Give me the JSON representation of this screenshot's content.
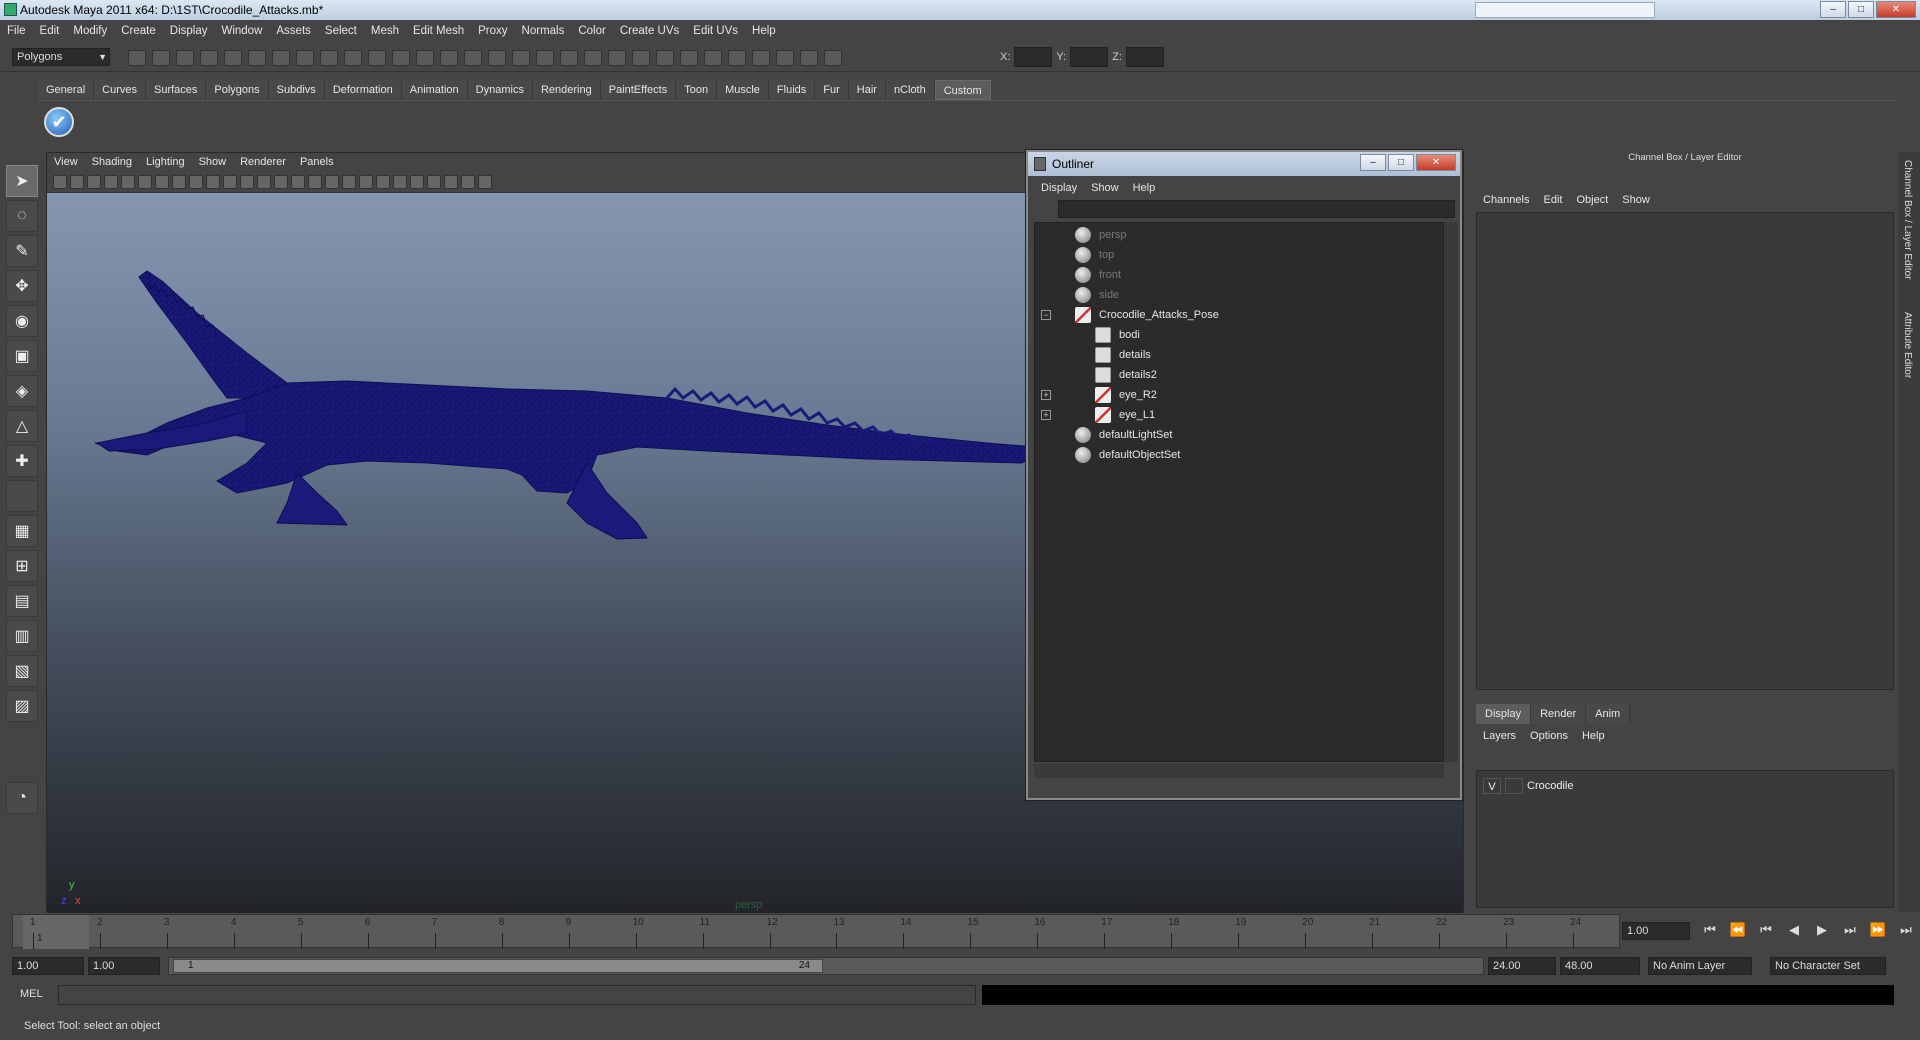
{
  "window": {
    "title": "Autodesk Maya 2011 x64: D:\\1ST\\Crocodile_Attacks.mb*",
    "min": "–",
    "max": "□",
    "close": "✕"
  },
  "menubar": [
    "File",
    "Edit",
    "Modify",
    "Create",
    "Display",
    "Window",
    "Assets",
    "Select",
    "Mesh",
    "Edit Mesh",
    "Proxy",
    "Normals",
    "Color",
    "Create UVs",
    "Edit UVs",
    "Help"
  ],
  "statusline": {
    "mode": "Polygons",
    "x_label": "X:",
    "y_label": "Y:",
    "z_label": "Z:"
  },
  "shelf_tabs": [
    "General",
    "Curves",
    "Surfaces",
    "Polygons",
    "Subdivs",
    "Deformation",
    "Animation",
    "Dynamics",
    "Rendering",
    "PaintEffects",
    "Toon",
    "Muscle",
    "Fluids",
    "Fur",
    "Hair",
    "nCloth",
    "Custom"
  ],
  "shelf_active": "Custom",
  "viewport": {
    "menu": [
      "View",
      "Shading",
      "Lighting",
      "Show",
      "Renderer",
      "Panels"
    ],
    "camera_label": "persp",
    "axis_y": "y",
    "axis_x": "x",
    "axis_z": "z",
    "mesh_color": "#1a1a7a"
  },
  "outliner": {
    "title": "Outliner",
    "menu": [
      "Display",
      "Show",
      "Help"
    ],
    "items": [
      {
        "label": "persp",
        "dim": true,
        "type": "camera"
      },
      {
        "label": "top",
        "dim": true,
        "type": "camera"
      },
      {
        "label": "front",
        "dim": true,
        "type": "camera"
      },
      {
        "label": "side",
        "dim": true,
        "type": "camera"
      },
      {
        "label": "Crocodile_Attacks_Pose",
        "dim": false,
        "type": "group",
        "expander": "−"
      },
      {
        "label": "bodi",
        "dim": false,
        "type": "mesh",
        "indent": 1
      },
      {
        "label": "details",
        "dim": false,
        "type": "mesh",
        "indent": 1
      },
      {
        "label": "details2",
        "dim": false,
        "type": "mesh",
        "indent": 1
      },
      {
        "label": "eye_R2",
        "dim": false,
        "type": "group",
        "indent": 1,
        "expander": "+"
      },
      {
        "label": "eye_L1",
        "dim": false,
        "type": "group",
        "indent": 1,
        "expander": "+"
      },
      {
        "label": "defaultLightSet",
        "dim": false,
        "type": "set"
      },
      {
        "label": "defaultObjectSet",
        "dim": false,
        "type": "set"
      }
    ]
  },
  "channel_box": {
    "header": "Channel Box / Layer Editor",
    "menu": [
      "Channels",
      "Edit",
      "Object",
      "Show"
    ]
  },
  "layer_editor": {
    "tabs": [
      "Display",
      "Render",
      "Anim"
    ],
    "active_tab": "Display",
    "menu": [
      "Layers",
      "Options",
      "Help"
    ],
    "layers": [
      {
        "visible": "V",
        "name": "Crocodile"
      }
    ]
  },
  "side_tabs": [
    "Channel Box / Layer Editor",
    "Attribute Editor"
  ],
  "timeline": {
    "ticks": [
      "1",
      "2",
      "3",
      "4",
      "5",
      "6",
      "7",
      "8",
      "9",
      "10",
      "11",
      "12",
      "13",
      "14",
      "15",
      "16",
      "17",
      "18",
      "19",
      "20",
      "21",
      "22",
      "23",
      "24"
    ],
    "current_frame_label": "1",
    "current_frame_field": "1.00"
  },
  "playback": [
    "⏮",
    "⏪",
    "⏮",
    "◀",
    "▶",
    "⏭",
    "⏩",
    "⏭"
  ],
  "range": {
    "start_time": "1.00",
    "playback_start": "1.00",
    "slider_start": "1",
    "slider_end": "24",
    "playback_end": "24.00",
    "end_time": "48.00",
    "anim_layer": "No Anim Layer",
    "character_set": "No Character Set"
  },
  "mel": {
    "label": "MEL"
  },
  "helpline": "Select Tool: select an object"
}
